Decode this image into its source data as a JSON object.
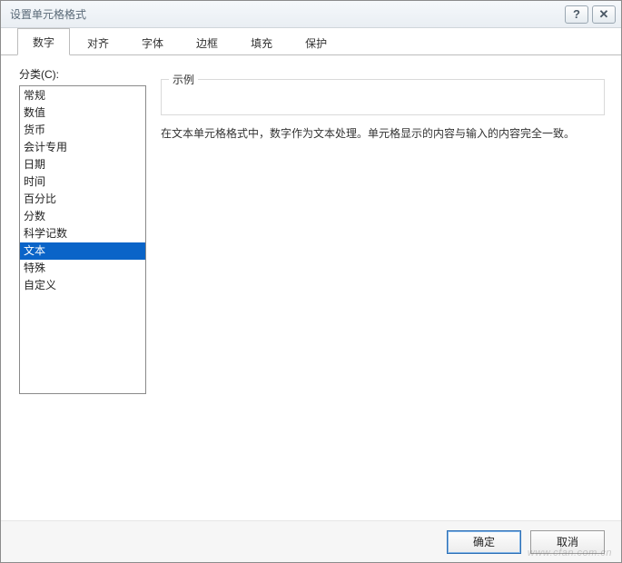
{
  "window": {
    "title": "设置单元格格式"
  },
  "titlebar_buttons": {
    "help": "?",
    "close": "✕"
  },
  "tabs": [
    {
      "label": "数字",
      "active": true
    },
    {
      "label": "对齐",
      "active": false
    },
    {
      "label": "字体",
      "active": false
    },
    {
      "label": "边框",
      "active": false
    },
    {
      "label": "填充",
      "active": false
    },
    {
      "label": "保护",
      "active": false
    }
  ],
  "category": {
    "label": "分类(C):",
    "items": [
      {
        "label": "常规",
        "selected": false
      },
      {
        "label": "数值",
        "selected": false
      },
      {
        "label": "货币",
        "selected": false
      },
      {
        "label": "会计专用",
        "selected": false
      },
      {
        "label": "日期",
        "selected": false
      },
      {
        "label": "时间",
        "selected": false
      },
      {
        "label": "百分比",
        "selected": false
      },
      {
        "label": "分数",
        "selected": false
      },
      {
        "label": "科学记数",
        "selected": false
      },
      {
        "label": "文本",
        "selected": true
      },
      {
        "label": "特殊",
        "selected": false
      },
      {
        "label": "自定义",
        "selected": false
      }
    ]
  },
  "sample": {
    "legend": "示例"
  },
  "description": "在文本单元格格式中，数字作为文本处理。单元格显示的内容与输入的内容完全一致。",
  "buttons": {
    "ok": "确定",
    "cancel": "取消"
  },
  "watermark": "www.cfan.com.cn"
}
